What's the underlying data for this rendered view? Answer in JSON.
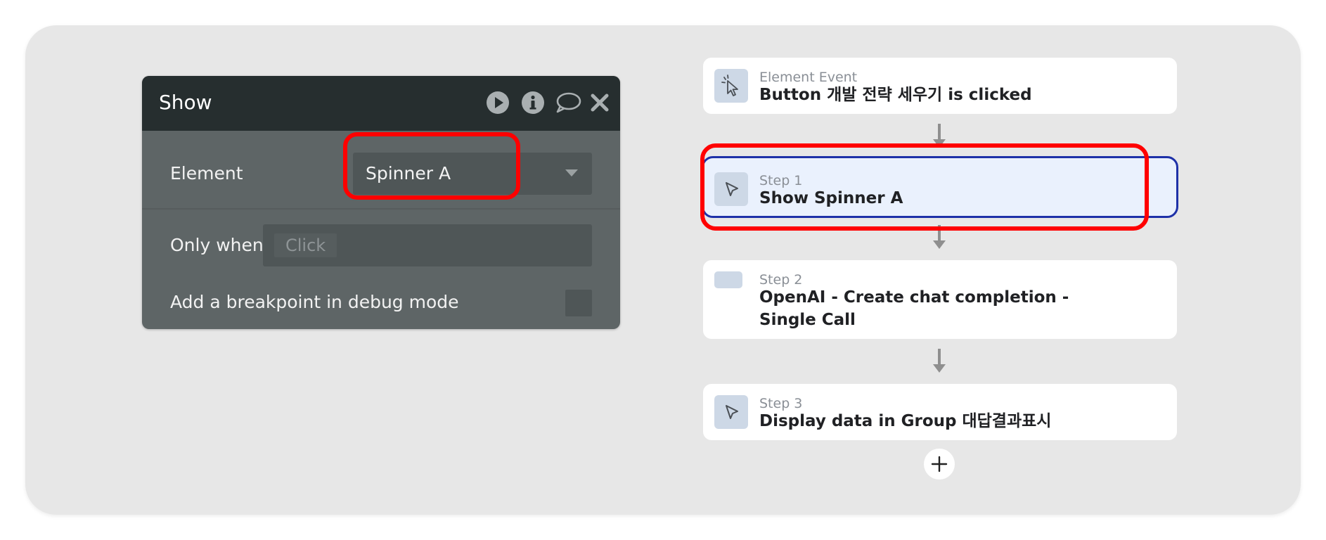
{
  "panel": {
    "title": "Show",
    "header_icons": [
      "play-circle-icon",
      "info-circle-icon",
      "comment-icon",
      "close-icon"
    ],
    "element_label": "Element",
    "element_value": "Spinner A",
    "only_when_label": "Only when",
    "only_when_placeholder": "Click",
    "breakpoint_label": "Add a breakpoint in debug mode",
    "breakpoint_checked": false
  },
  "workflow": {
    "event": {
      "kicker": "Element Event",
      "title": "Button 개발 전략 세우기 is clicked",
      "icon": "cursor-sparkle-icon"
    },
    "steps": [
      {
        "kicker": "Step 1",
        "title": "Show Spinner A",
        "icon": "cursor-icon",
        "selected": true
      },
      {
        "kicker": "Step 2",
        "title": "OpenAI - Create chat completion - Single Call",
        "icon": "plugin-icon",
        "selected": false
      },
      {
        "kicker": "Step 3",
        "title": "Display data in Group 대답결과표시",
        "icon": "cursor-icon",
        "selected": false
      }
    ],
    "add_icon": "plus-icon"
  },
  "colors": {
    "canvas": "#e7e7e7",
    "panel_header": "#262e2f",
    "panel_body": "#5e6566",
    "selected_border": "#1e31a8",
    "selected_fill": "#eaf1fd",
    "highlight": "#ff0000"
  }
}
